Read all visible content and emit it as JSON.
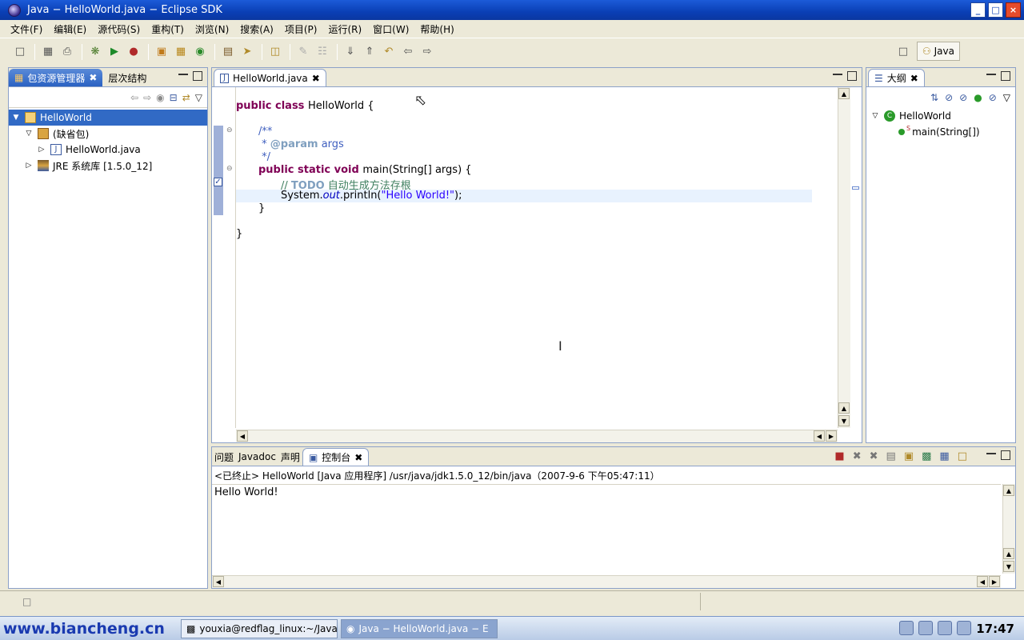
{
  "window": {
    "title": "Java − HelloWorld.java − Eclipse SDK",
    "controls": [
      "_",
      "□",
      "×"
    ]
  },
  "menubar": [
    "文件(F)",
    "编辑(E)",
    "源代码(S)",
    "重构(T)",
    "浏览(N)",
    "搜索(A)",
    "项目(P)",
    "运行(R)",
    "窗口(W)",
    "帮助(H)"
  ],
  "perspective": {
    "label": "Java"
  },
  "package_explorer": {
    "tabs": [
      "包资源管理器",
      "层次结构"
    ],
    "tree": [
      {
        "label": "HelloWorld",
        "level": 0,
        "twisty": "▼",
        "selected": true,
        "icon": "project-icon"
      },
      {
        "label": "(缺省包)",
        "level": 1,
        "twisty": "▽",
        "selected": false,
        "icon": "package-icon"
      },
      {
        "label": "HelloWorld.java",
        "level": 2,
        "twisty": "▷",
        "selected": false,
        "icon": "java-file-icon"
      },
      {
        "label": "JRE 系统库 [1.5.0_12]",
        "level": 1,
        "twisty": "▷",
        "selected": false,
        "icon": "library-icon"
      }
    ]
  },
  "editor": {
    "tab_label": "HelloWorld.java",
    "code": {
      "l1_kw": "public class ",
      "l1_rest": "HelloWorld {",
      "l2": "/**",
      "l3_pre": " * ",
      "l3_tag": "@param",
      "l3_rest": " args",
      "l4": " */",
      "l5_kw": "public static void ",
      "l5_rest": "main(String[] args) {",
      "l6_pre": "// ",
      "l6_todo": "TODO",
      "l6_rest": " 自动生成方法存根",
      "l7_a": "System.",
      "l7_out": "out",
      "l7_b": ".println(",
      "l7_str": "\"Hello World!\"",
      "l7_c": ");",
      "l8": "}",
      "l9": "}"
    }
  },
  "outline": {
    "tab_label": "大纲",
    "class_name": "HelloWorld",
    "method": "main(String[])",
    "static_marker": "S"
  },
  "console": {
    "tabs": [
      "问题",
      "Javadoc",
      "声明",
      "控制台"
    ],
    "status": "<已终止> HelloWorld [Java 应用程序] /usr/java/jdk1.5.0_12/bin/java（2007-9-6 下午05:47:11）",
    "output": "Hello World!"
  },
  "taskbar": {
    "logo": "www.biancheng.cn",
    "tasks": [
      "youxia@redflag_linux:~/Java/e",
      "Java − HelloWorld.java − E"
    ],
    "clock": "17:47"
  }
}
